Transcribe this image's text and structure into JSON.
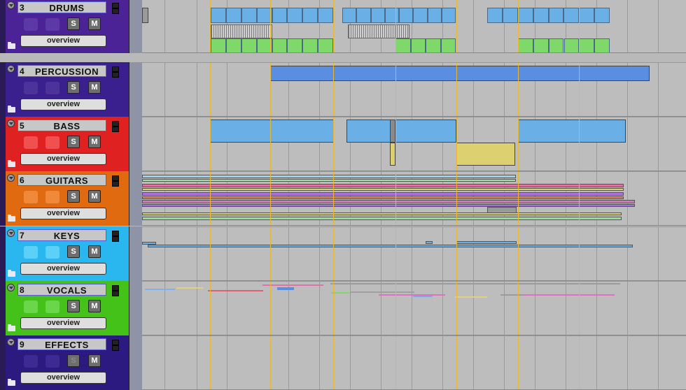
{
  "tracks": [
    {
      "num": "3",
      "name": "DRUMS",
      "overview_label": "overview",
      "solo_label": "S",
      "mute_label": "M",
      "color": "#4b2396",
      "pad_color": "#5b3aa5",
      "solo_dim": false
    },
    {
      "num": "4",
      "name": "PERCUSSION",
      "overview_label": "overview",
      "solo_label": "S",
      "mute_label": "M",
      "color": "#3a1f8f",
      "pad_color": "#4d3399",
      "solo_dim": false
    },
    {
      "num": "5",
      "name": "BASS",
      "overview_label": "overview",
      "solo_label": "S",
      "mute_label": "M",
      "color": "#e02121",
      "pad_color": "#f05050",
      "solo_dim": false
    },
    {
      "num": "6",
      "name": "GUITARS",
      "overview_label": "overview",
      "solo_label": "S",
      "mute_label": "M",
      "color": "#e06a10",
      "pad_color": "#f08a3a",
      "solo_dim": false
    },
    {
      "num": "7",
      "name": "KEYS",
      "overview_label": "overview",
      "solo_label": "S",
      "mute_label": "M",
      "color": "#2ab6ee",
      "pad_color": "#5cd0f7",
      "solo_dim": false
    },
    {
      "num": "8",
      "name": "VOCALS",
      "overview_label": "overview",
      "solo_label": "S",
      "mute_label": "M",
      "color": "#45c21a",
      "pad_color": "#6ad64a",
      "solo_dim": false
    },
    {
      "num": "9",
      "name": "EFFECTS",
      "overview_label": "overview",
      "solo_label": "S",
      "mute_label": "M",
      "color": "#2d1a80",
      "pad_color": "#3d2a92",
      "solo_dim": true
    }
  ],
  "colors": {
    "marker": "#e8b830",
    "grid": "#9a9a9a",
    "clip_blue": "#6ab0e6",
    "clip_green": "#7ed86a",
    "clip_yellow": "#dcd070",
    "clip_perc": "#5a8ee0"
  }
}
